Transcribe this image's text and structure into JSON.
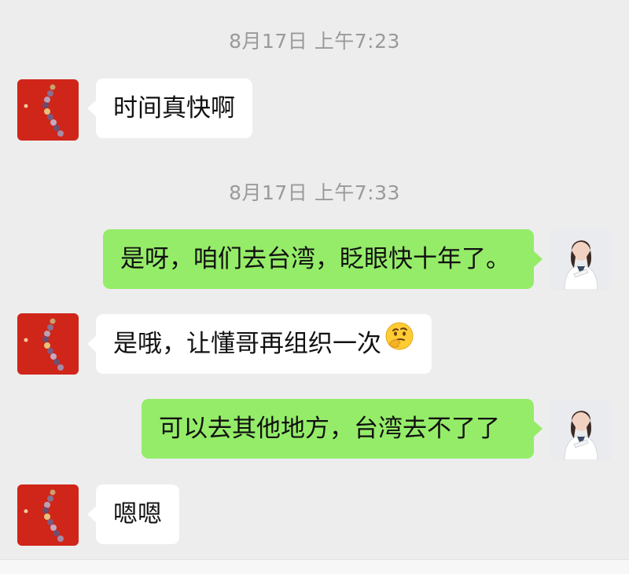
{
  "chat": {
    "timestamps": [
      "8月17日 上午7:23",
      "8月17日 上午7:33"
    ],
    "messages": [
      {
        "sender": "other",
        "text": "时间真快啊"
      },
      {
        "sender": "me",
        "text": "是呀，咱们去台湾，眨眼快十年了。"
      },
      {
        "sender": "other",
        "text": "是哦，让懂哥再组织一次",
        "emoji": "thinking-face-icon"
      },
      {
        "sender": "me",
        "text": "可以去其他地方，台湾去不了了"
      },
      {
        "sender": "other",
        "text": "嗯嗯"
      }
    ]
  },
  "colors": {
    "background": "#ededed",
    "incoming_bubble": "#ffffff",
    "outgoing_bubble": "#95ec69",
    "timestamp": "#9a9a9a"
  }
}
